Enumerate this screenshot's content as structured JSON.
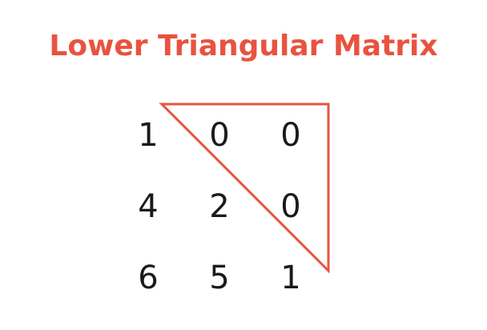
{
  "title": "Lower Triangular Matrix",
  "colors": {
    "accent": "#e8533f",
    "text": "#1a1a1a",
    "background": "#ffffff"
  },
  "matrix": {
    "rows": [
      [
        "1",
        "0",
        "0"
      ],
      [
        "4",
        "2",
        "0"
      ],
      [
        "6",
        "5",
        "1"
      ]
    ]
  }
}
